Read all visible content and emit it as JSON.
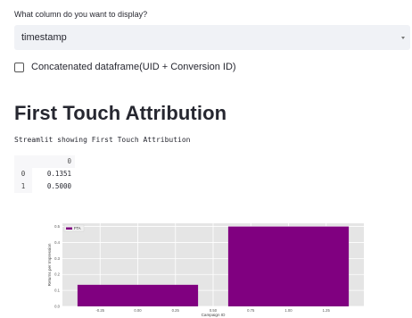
{
  "prompt_label": "What column do you want to display?",
  "select": {
    "value": "timestamp"
  },
  "checkbox": {
    "label": "Concatenated dataframe(UID + Conversion ID)"
  },
  "heading": "First Touch Attribution",
  "subtext": "Streamlit showing First Touch Attribution",
  "dataframe": {
    "column": "0",
    "rows": [
      {
        "index": "0",
        "value": "0.1351"
      },
      {
        "index": "1",
        "value": "0.5000"
      }
    ]
  },
  "colors": {
    "bar": "#800080",
    "plot_bg": "#e5e5e5",
    "select_bg": "#f0f2f6"
  },
  "chart_data": {
    "type": "bar",
    "categories": [
      0,
      1
    ],
    "series": [
      {
        "name": "FTA",
        "values": [
          0.1351,
          0.5
        ]
      }
    ],
    "xlabel": "Campaign ID",
    "ylabel": "Returns per Impression",
    "xlim": [
      -0.5,
      1.5
    ],
    "ylim": [
      0,
      0.52
    ],
    "xticks": [
      "-0.25",
      "0.00",
      "0.25",
      "0.50",
      "0.75",
      "1.00",
      "1.25"
    ],
    "yticks": [
      "0.0",
      "0.1",
      "0.2",
      "0.3",
      "0.4",
      "0.5"
    ],
    "grid": true,
    "legend": "top-left"
  }
}
